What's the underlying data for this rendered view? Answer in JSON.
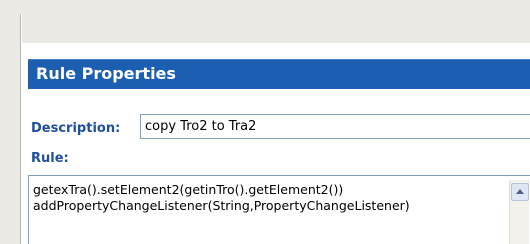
{
  "panel": {
    "title": "Rule Properties"
  },
  "description": {
    "label": "Description:",
    "value": "copy Tro2 to Tra2"
  },
  "rule": {
    "label": "Rule:",
    "lines": [
      "getexTra().setElement2(getinTro().getElement2())",
      "addPropertyChangeListener(String,PropertyChangeListener)"
    ]
  },
  "colors": {
    "header_background": "#1c5fb0",
    "label_text": "#1f4fa0",
    "chrome_background": "#ebe9e4"
  },
  "icons": {
    "scroll_up": "scroll-up-arrow-icon"
  }
}
